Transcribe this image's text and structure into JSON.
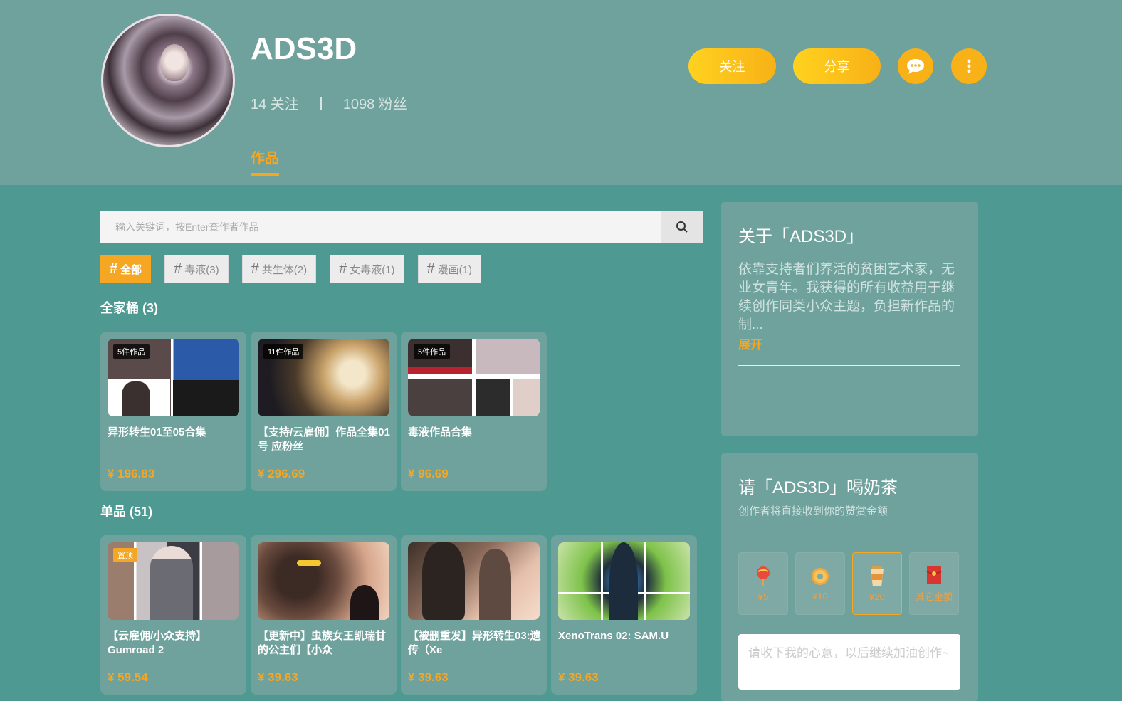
{
  "profile": {
    "name": "ADS3D",
    "following": "14 关注",
    "followers": "1098 粉丝",
    "tab": "作品",
    "follow_label": "关注",
    "share_label": "分享"
  },
  "search": {
    "placeholder": "输入关键词，按Enter查作者作品"
  },
  "tags": [
    {
      "label": "全部",
      "active": true
    },
    {
      "label": "毒液(3)"
    },
    {
      "label": "共生体(2)"
    },
    {
      "label": "女毒液(1)"
    },
    {
      "label": "漫画(1)"
    }
  ],
  "bundles": {
    "title": "全家桶 (3)",
    "items": [
      {
        "badge": "5件作品",
        "title": "异形转生01至05合集",
        "price": "¥ 196.83"
      },
      {
        "badge": "11件作品",
        "title": "【支持/云雇佣】作品全集01号 应粉丝",
        "price": "¥ 296.69"
      },
      {
        "badge": "5件作品",
        "title": "毒液作品合集",
        "price": "¥ 96.69"
      }
    ]
  },
  "singles": {
    "title": "单品 (51)",
    "items": [
      {
        "badge": "置顶",
        "title": "【云雇佣/小众支持】Gumroad 2",
        "price": "¥ 59.54"
      },
      {
        "title": "【更新中】虫族女王凯瑞甘的公主们【小众",
        "price": "¥ 39.63"
      },
      {
        "title": "【被删重发】异形转生03:遗传（Xe",
        "price": "¥ 39.63"
      },
      {
        "title": "XenoTrans 02: SAM.U",
        "price": "¥ 39.63"
      }
    ]
  },
  "about": {
    "title": "关于「ADS3D」",
    "desc": "依靠支持者们养活的贫困艺术家，无业女青年。我获得的所有收益用于继续创作同类小众主题，负担新作品的制...",
    "expand": "展开"
  },
  "tip": {
    "title": "请「ADS3D」喝奶茶",
    "subtitle": "创作者将直接收到你的赞赏金额",
    "options": [
      "¥5",
      "¥10",
      "¥20",
      "其它金额"
    ],
    "message_placeholder": "请收下我的心意，以后继续加油创作~"
  }
}
